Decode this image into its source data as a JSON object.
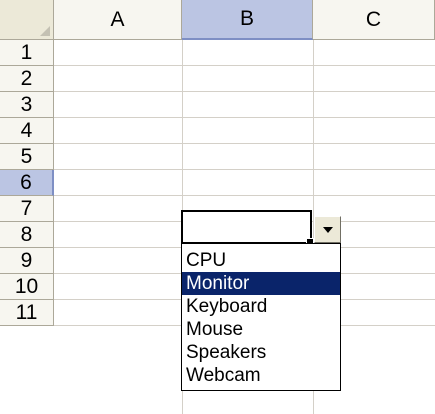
{
  "columns": [
    {
      "label": "A",
      "selected": false
    },
    {
      "label": "B",
      "selected": true
    },
    {
      "label": "C",
      "selected": false
    }
  ],
  "rows": [
    {
      "label": "1",
      "selected": false
    },
    {
      "label": "2",
      "selected": false
    },
    {
      "label": "3",
      "selected": false
    },
    {
      "label": "4",
      "selected": false
    },
    {
      "label": "5",
      "selected": false
    },
    {
      "label": "6",
      "selected": true
    },
    {
      "label": "7",
      "selected": false
    },
    {
      "label": "8",
      "selected": false
    },
    {
      "label": "9",
      "selected": false
    },
    {
      "label": "10",
      "selected": false
    },
    {
      "label": "11",
      "selected": false
    }
  ],
  "active_cell": {
    "column": "B",
    "row": "6",
    "value": ""
  },
  "dropdown": {
    "icon": "chevron-down-icon",
    "selected_index": 1,
    "options": [
      "CPU",
      "Monitor",
      "Keyboard",
      "Mouse",
      "Speakers",
      "Webcam"
    ]
  },
  "colors": {
    "header_bg": "#f7f6f0",
    "header_selected_bg": "#bbc5e3",
    "gridline": "#d4d0c8",
    "list_highlight": "#0a246a"
  }
}
